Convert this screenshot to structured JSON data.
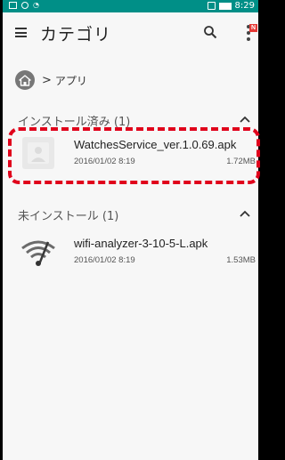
{
  "status_bar": {
    "time": "8:29",
    "background": "#008f87"
  },
  "app_bar": {
    "title": "カテゴリ",
    "badge": "N",
    "icons": [
      "menu-icon",
      "search-icon",
      "overflow-menu-icon"
    ]
  },
  "breadcrumb": {
    "separator": ">",
    "label": "アプリ"
  },
  "sections": [
    {
      "label": "インストール済み (1)",
      "files": [
        {
          "name": "WatchesService_ver.1.0.69.apk",
          "date": "2016/01/02 8:19",
          "size": "1.72MB",
          "icon": "generic-apk-icon"
        }
      ]
    },
    {
      "label": "未インストール (1)",
      "files": [
        {
          "name": "wifi-analyzer-3-10-5-L.apk",
          "date": "2016/01/02 8:19",
          "size": "1.53MB",
          "icon": "wifi-analyzer-icon"
        }
      ]
    }
  ],
  "highlight_color": "#e0001b"
}
